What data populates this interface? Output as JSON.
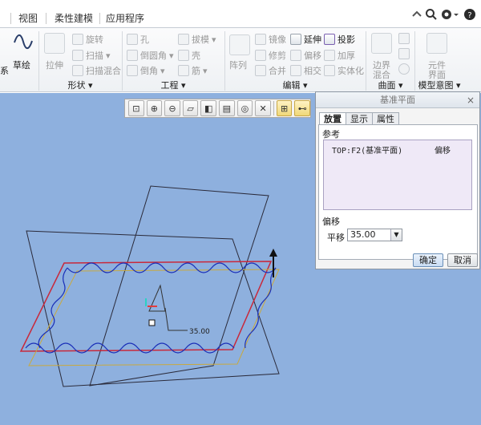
{
  "tabs": [
    "视图",
    "柔性建模",
    "应用程序"
  ],
  "ribbon": {
    "left_partial": {
      "sketch_icon": "sketch-icon",
      "left_text": "系",
      "sketch": "草绘"
    },
    "shape": {
      "extrude": "拉伸",
      "revolve": "旋转",
      "sweep": "扫描",
      "swept_blend": "扫描混合",
      "label": "形状 ▾"
    },
    "engineering": {
      "hole": "孔",
      "round": "倒圆角",
      "chamfer": "倒角",
      "draft": "拔模",
      "shell": "壳",
      "rib": "筋",
      "label": "工程 ▾"
    },
    "edit": {
      "pattern": "阵列",
      "mirror": "镜像",
      "trim": "修剪",
      "merge": "合并",
      "extend": "延伸",
      "offset": "偏移",
      "intersect": "相交",
      "project": "投影",
      "thicken": "加厚",
      "solidify": "实体化",
      "label": "编辑 ▾"
    },
    "surface": {
      "boundary_blend_1": "边界",
      "boundary_blend_2": "混合",
      "label": "曲面 ▾"
    },
    "model_intent": {
      "component_1": "元件",
      "component_2": "界面",
      "label": "模型意图 ▾"
    }
  },
  "dialog": {
    "title": "基准平面",
    "close": "×",
    "tabs": [
      "放置",
      "显示",
      "属性"
    ],
    "references_label": "参考",
    "reference": {
      "name": "TOP:F2(基准平面)",
      "type": "偏移"
    },
    "offset_label": "偏移",
    "translate_label": "平移",
    "translate_value": "35.00",
    "ok": "确定",
    "cancel": "取消"
  },
  "scene": {
    "dimension_label": "35.00"
  },
  "colors": {
    "viewport": "#8eb0de",
    "datum": "#c9283a",
    "curve": "#1a2fb8",
    "preview": "#c9a93e"
  }
}
